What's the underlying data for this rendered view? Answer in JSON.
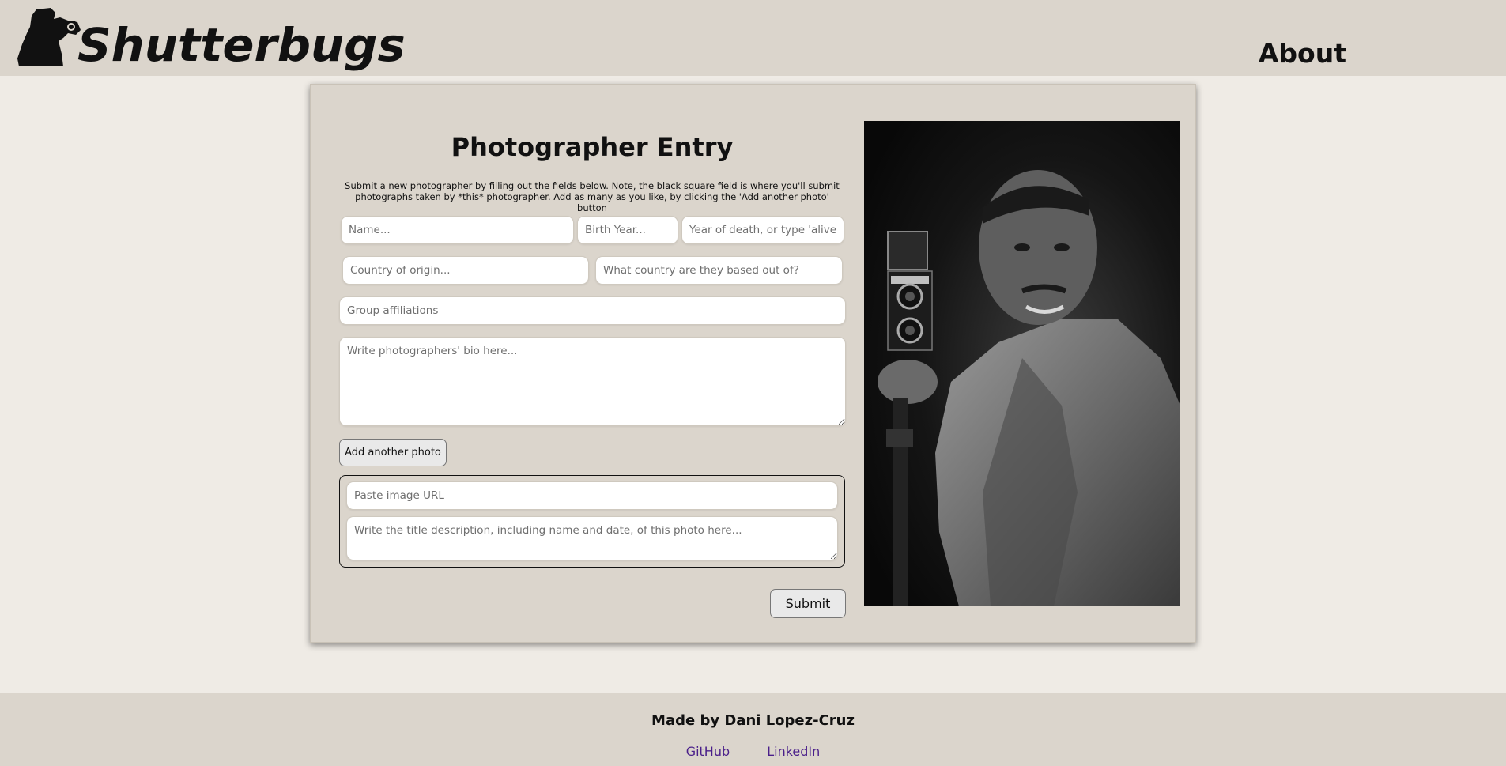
{
  "header": {
    "brand": "Shutterbugs",
    "nav_about": "About"
  },
  "form": {
    "title": "Photographer Entry",
    "instructions": "Submit a new photographer by filling out the fields below. Note, the black square field is where you'll submit photographs taken by *this* photographer. Add as many as you like, by clicking the 'Add another photo' button",
    "name_placeholder": "Name...",
    "birth_placeholder": "Birth Year...",
    "death_placeholder": "Year of death, or type 'alive'",
    "origin_placeholder": "Country of origin...",
    "based_placeholder": "What country are they based out of?",
    "group_placeholder": "Group affiliations",
    "bio_placeholder": "Write photographers' bio here...",
    "add_photo_label": "Add another photo",
    "image_url_placeholder": "Paste image URL",
    "photo_desc_placeholder": "Write the title description, including name and date, of this photo here...",
    "submit_label": "Submit"
  },
  "footer": {
    "credit": "Made by Dani Lopez-Cruz",
    "github": "GitHub",
    "linkedin": "LinkedIn"
  }
}
